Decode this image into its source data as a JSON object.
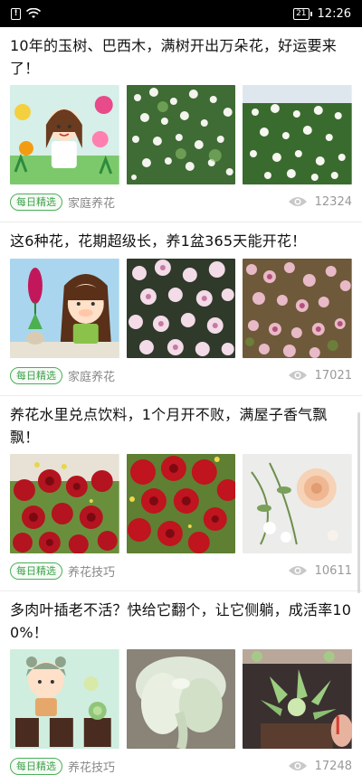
{
  "status_bar": {
    "sim_label": "!",
    "battery_level": "21",
    "time": "12:26"
  },
  "feed": [
    {
      "title": "10年的玉树、巴西木，满树开出万朵花，好运要来了！",
      "tag": "每日精选",
      "source": "家庭养花",
      "views": "12324",
      "images": [
        "cartoon-girl-flowers",
        "white-flower-bush",
        "white-flower-tree"
      ]
    },
    {
      "title": "这6种花，花期超级长，养1盆365天能开花！",
      "tag": "每日精选",
      "source": "家庭养花",
      "views": "17021",
      "images": [
        "cartoon-hyacinth-girl",
        "pink-white-flowers",
        "bougainvillea"
      ]
    },
    {
      "title": "养花水里兑点饮料，1个月开不败，满屋子香气飘飘！",
      "tag": "每日精选",
      "source": "养花技巧",
      "views": "10611",
      "images": [
        "red-roses-bouquet",
        "red-roses-close",
        "peach-rose"
      ]
    },
    {
      "title": "多肉叶插老不活？快给它翻个，让它侧躺，成活率100%！",
      "tag": "每日精选",
      "source": "养花技巧",
      "views": "17248",
      "images": [
        "cartoon-succulent-pots",
        "succulent-leaf",
        "succulent-potted"
      ]
    }
  ]
}
